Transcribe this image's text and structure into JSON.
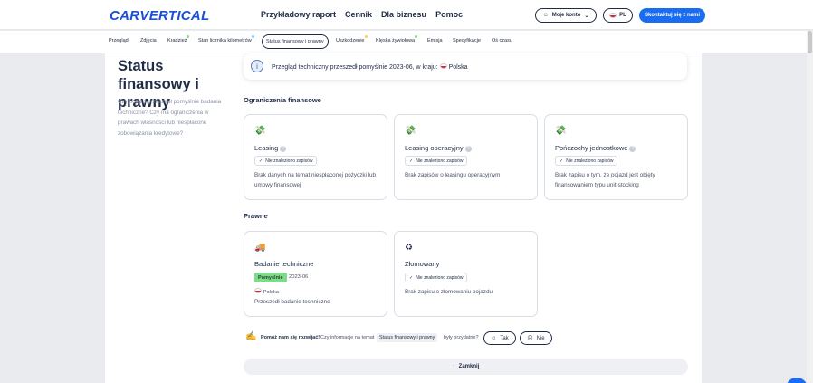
{
  "header": {
    "logo": "CARVERTICAL",
    "nav": [
      "Przykładowy raport",
      "Cennik",
      "Dla biznesu",
      "Pomoc"
    ],
    "account_label": "Moje konto",
    "lang_label": "PL",
    "contact_label": "Skontaktuj się z nami"
  },
  "subnav": {
    "items": [
      {
        "label": "Przegląd"
      },
      {
        "label": "Zdjęcia"
      },
      {
        "label": "Kradzież"
      },
      {
        "label": "Stan licznika kilometrów"
      },
      {
        "label": "Status finansowy i prawny"
      },
      {
        "label": "Uszkodzenie"
      },
      {
        "label": "Klęska żywiołowa"
      },
      {
        "label": "Emisja"
      },
      {
        "label": "Specyfikacje"
      },
      {
        "label": "Oś czasu"
      }
    ],
    "active_index": 4
  },
  "section": {
    "title": "Status finansowy i prawny",
    "description": "Czy pojazd przeszedł pomyślnie badania techniczne? Czy ma ograniczenia w prawach własności lub niespłacone zobowiązania kredytowe?"
  },
  "info": {
    "text": "Przegląd techniczny przeszedł pomyślnie 2023-06, w kraju:",
    "country": "Polska"
  },
  "financial": {
    "title": "Ograniczenia finansowe",
    "cards": [
      {
        "title": "Leasing",
        "badge": "Nie znaleziono zapisów",
        "text": "Brak danych na temat niespłaconej pożyczki lub umowy finansowej"
      },
      {
        "title": "Leasing operacyjny",
        "badge": "Nie znaleziono zapisów",
        "text": "Brak zapisów o leasingu operacyjnym"
      },
      {
        "title": "Pończochy jednostkowe",
        "badge": "Nie znaleziono zapisów",
        "text": "Brak zapisu o tym, że pojazd jest objęty finansowaniem typu unit-stocking"
      }
    ]
  },
  "legal": {
    "title": "Prawne",
    "inspection": {
      "title": "Badanie techniczne",
      "status": "Pomyślnie",
      "date": "2023-06",
      "country": "Polska",
      "text": "Przeszedł badanie techniczne"
    },
    "scrapped": {
      "title": "Złomowany",
      "badge": "Nie znaleziono zapisów",
      "text": "Brak zapisu o złomowaniu pojazdu"
    }
  },
  "feedback": {
    "strong": "Pomóż nam się rozwijać!",
    "question": "Czy informacje na temat",
    "chip": "Status finansowy i prawny",
    "end": "były przydatne?",
    "yes": "Tak",
    "no": "Nie"
  },
  "close_label": "Zamknij",
  "colors": {
    "brand": "#1a6cf0",
    "pass": "#7edb8c"
  }
}
